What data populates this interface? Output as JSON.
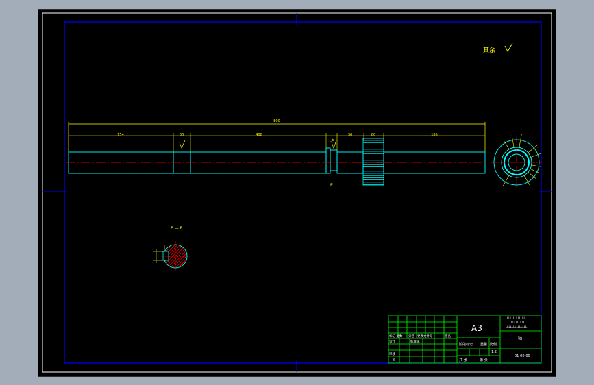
{
  "drawing": {
    "surface_note": "其余",
    "overall_length": "800",
    "segment_dims": [
      "154",
      "30",
      "408",
      "30",
      "80",
      "185"
    ],
    "section_label_top": "E",
    "section_label_bottom": "E",
    "section_view_title": "E — E",
    "colors": {
      "background": "#000000",
      "frame": "#ffffff",
      "border": "#0000ff",
      "outline": "#00ffff",
      "dimension": "#ffff00",
      "centerline": "#ff0000",
      "hatch": "#ff0000",
      "titleblock": "#00ff00"
    }
  },
  "title_block": {
    "sheet_size": "A3",
    "company_line1": "LLLLLLLLLLLL",
    "company_line2": "LLLLLLLLL",
    "company_line3": "LLLLLLLLLLLLLL",
    "part_name": "轴",
    "drawing_no": "01-00-00",
    "scale": "1:2",
    "labels": {
      "mark": "标记 处数",
      "division": "分区",
      "change_doc": "更改文件号",
      "signature": "签名",
      "design": "设计",
      "standardize": "标准化",
      "stage_mark": "阶段标记",
      "weight": "重量",
      "scale_label": "比例",
      "sheet": "共  张",
      "sheet_of": "第  张",
      "review": "审核",
      "process": "工艺"
    }
  }
}
